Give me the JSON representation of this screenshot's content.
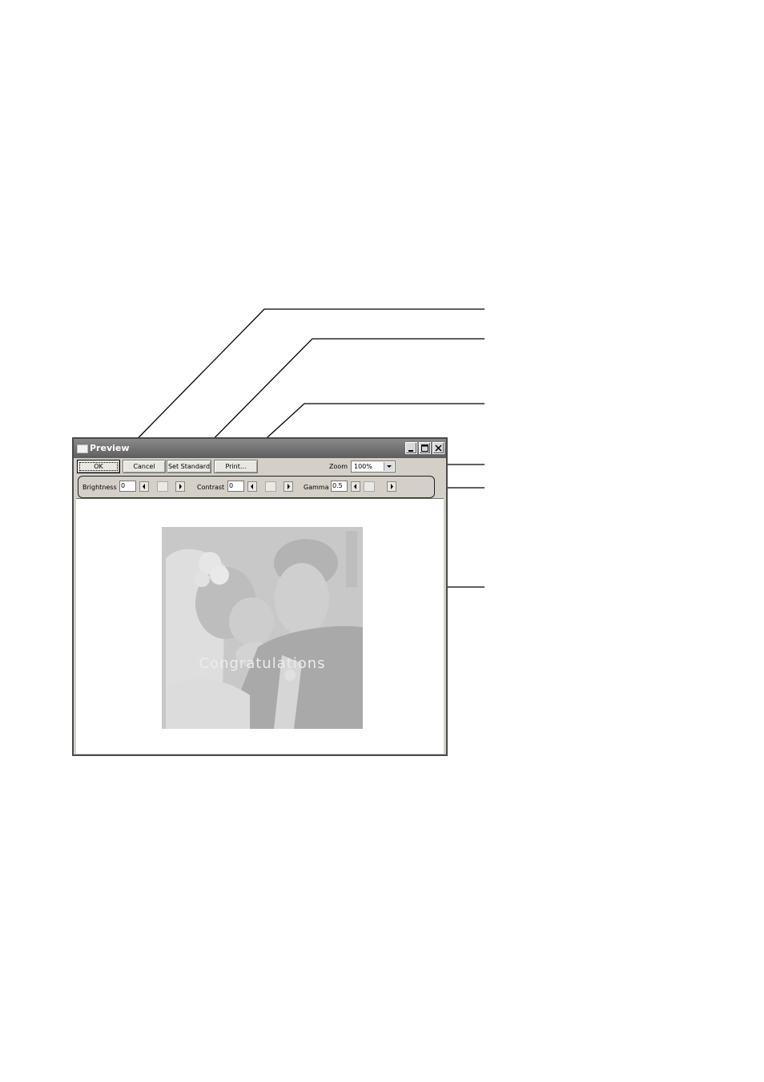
{
  "window": {
    "title": "Preview",
    "controls": [
      "minimize-icon",
      "maximize-icon",
      "close-icon"
    ]
  },
  "toolbar": {
    "ok_label": "OK",
    "cancel_label": "Cancel",
    "set_standard_label": "Set Standard",
    "print_label": "Print...",
    "zoom_label": "Zoom",
    "zoom_value": "100%"
  },
  "adjustments": {
    "brightness_label": "Brightness",
    "brightness_value": "0",
    "contrast_label": "Contrast",
    "contrast_value": "0",
    "gamma_label": "Gamma",
    "gamma_value": "0.5"
  },
  "preview": {
    "caption": "Congratulations"
  },
  "colors": {
    "titlebar": "#6e6e6e",
    "window_bg": "#d4d0c8",
    "photo_tint": "#c9c9c9"
  }
}
